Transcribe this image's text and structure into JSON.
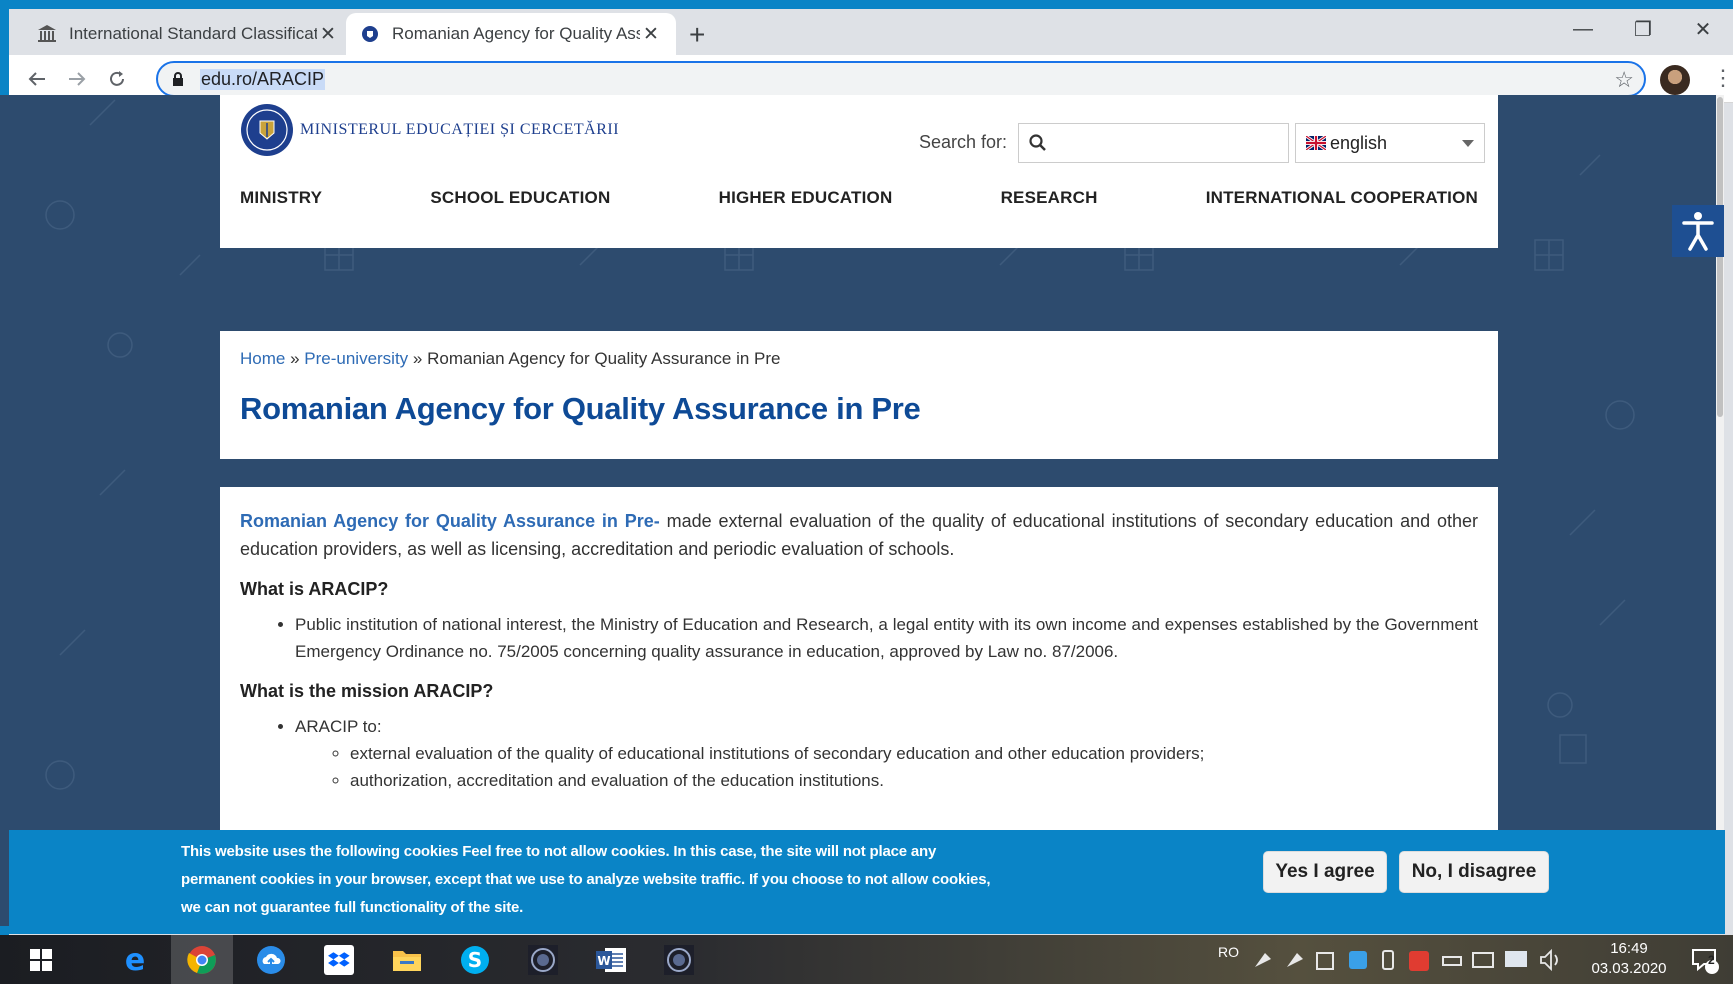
{
  "browser": {
    "tabs": [
      {
        "title": "International Standard Classificat",
        "active": false
      },
      {
        "title": "Romanian Agency for Quality Ass",
        "active": true
      }
    ],
    "new_tab_label": "+",
    "url": "edu.ro/ARACIP",
    "window_controls": {
      "minimize": "—",
      "restore": "❐",
      "close": "✕"
    }
  },
  "site": {
    "logo_text": "MINISTERUL EDUCAȚIEI ȘI CERCETĂRII",
    "search_label": "Search for:",
    "search_placeholder": "",
    "language": "english",
    "nav": [
      "MINISTRY",
      "SCHOOL EDUCATION",
      "HIGHER EDUCATION",
      "RESEARCH",
      "INTERNATIONAL COOPERATION"
    ]
  },
  "breadcrumb": {
    "home": "Home",
    "sep1": " » ",
    "level1": "Pre-university",
    "sep2": " » ",
    "current": "Romanian Agency for Quality Assurance in Pre"
  },
  "page_title": "Romanian Agency for Quality Assurance in Pre",
  "content": {
    "intro_lead": "Romanian Agency for Quality Assurance in Pre-",
    "intro_rest": " made external evaluation of the quality of educational institutions of secondary education and other education providers, as well as licensing, accreditation and periodic evaluation of schools.",
    "h_what": "What is ARACIP?",
    "what_item": "Public institution of national interest, the Ministry of Education and Research, a legal entity with its own income and expenses established by the Government Emergency Ordinance no. 75/2005 concerning quality assurance in education, approved by Law no. 87/2006.",
    "h_mission": "What is the mission ARACIP?",
    "mission_item": "ARACIP to:",
    "mission_sub": [
      "external evaluation of the quality of educational institutions of secondary education and other education providers;",
      "authorization, accreditation and evaluation of the education institutions."
    ]
  },
  "cookie": {
    "text": "This website uses the following cookies Feel free to not allow cookies. In this case, the site will not place any permanent cookies in your browser, except that we use to analyze website traffic. If you choose to not allow cookies, we can not guarantee full functionality of the site.",
    "agree": "Yes I agree",
    "disagree": "No, I disagree"
  },
  "taskbar": {
    "lang": "RO",
    "time": "16:49",
    "date": "03.03.2020",
    "notification_count": "2"
  },
  "colors": {
    "accent_blue": "#0a84c6",
    "page_bg": "#2d4b6e",
    "title_blue": "#0e4a96",
    "link_blue": "#2e6bb5"
  }
}
